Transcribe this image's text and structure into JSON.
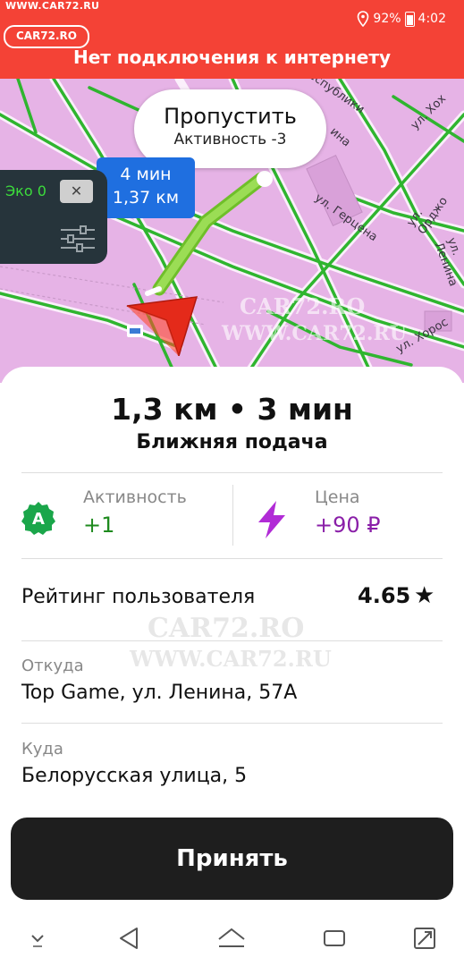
{
  "status_bar": {
    "watermark_url": "WWW.CAR72.RU",
    "watermark_logo": "CAR72.RO",
    "battery": "92%",
    "time": "4:02",
    "banner": "Нет подключения к интернету"
  },
  "map": {
    "streets": [
      "еспублики",
      "ул. Хох",
      "ина",
      "ул. Орджо",
      "ул. Герцена",
      "ул. Ленина",
      "ул. Хорос"
    ],
    "skip": {
      "title": "Пропустить",
      "subtitle": "Активность -3"
    },
    "eta": {
      "time": "4 мин",
      "distance": "1,37 км"
    },
    "eco": {
      "label": "Эко 0"
    },
    "watermark_logo": "CAR72.RO",
    "watermark_url": "WWW.CAR72.RU"
  },
  "order": {
    "headline": "1,3 км • 3 мин",
    "subline": "Ближняя подача",
    "activity": {
      "label": "Активность",
      "value": "+1",
      "icon_letter": "A"
    },
    "price": {
      "label": "Цена",
      "value": "+90 ₽"
    },
    "rating": {
      "label": "Рейтинг пользователя",
      "value": "4.65",
      "star": "★"
    },
    "from": {
      "label": "Откуда",
      "value": "Top Game, ул. Ленина, 57А"
    },
    "to": {
      "label": "Куда",
      "value": "Белорусская улица, 5"
    },
    "watermark_logo": "CAR72.RO",
    "watermark_url": "WWW.CAR72.RU"
  },
  "accept_button": {
    "label": "Принять"
  },
  "colors": {
    "status_red": "#f44236",
    "map_bg": "#e6b3e6",
    "route_green": "#8fd14f",
    "eta_blue": "#1f6fe0",
    "activity_green": "#1e8a1e",
    "price_purple": "#8a1fa8"
  }
}
